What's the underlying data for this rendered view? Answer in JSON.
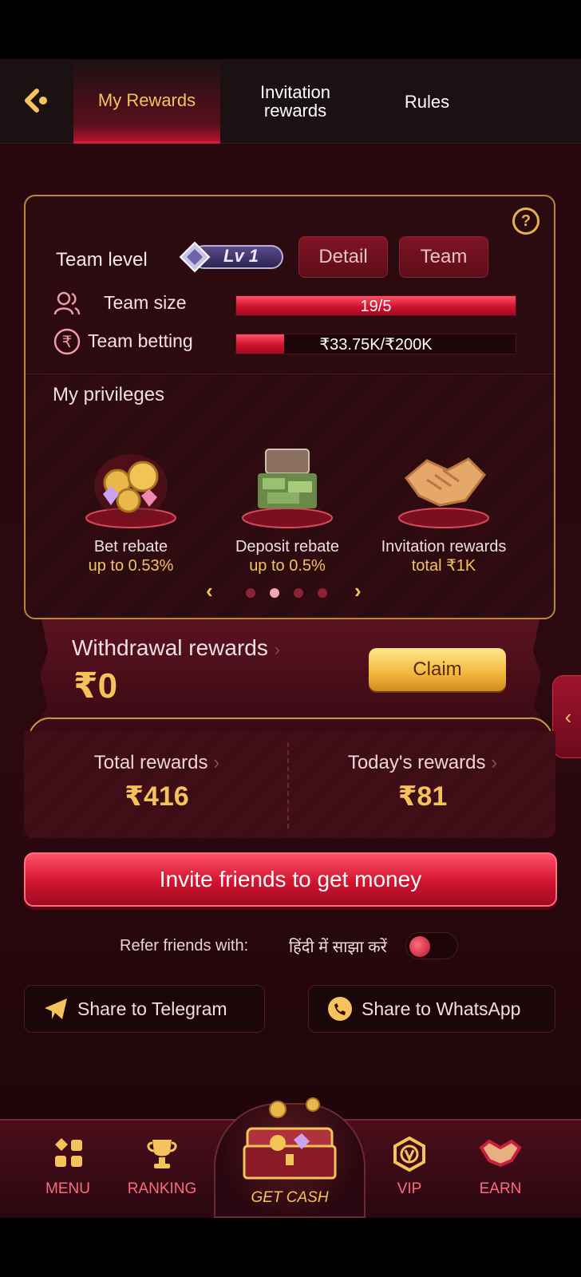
{
  "header": {
    "tabs": [
      {
        "label": "My Rewards",
        "active": true
      },
      {
        "label": "Invitation\nrewards",
        "active": false
      },
      {
        "label": "Rules",
        "active": false
      }
    ]
  },
  "team": {
    "label": "Team level",
    "level_badge": "Lv 1",
    "detail_button": "Detail",
    "team_button": "Team",
    "size_label": "Team size",
    "size_value": "19/5",
    "size_progress": 1.0,
    "betting_label": "Team betting",
    "betting_value": "₹33.75K/₹200K",
    "betting_progress": 0.17
  },
  "privileges": {
    "title": "My privileges",
    "items": [
      {
        "name": "Bet rebate",
        "value": "up to 0.53%"
      },
      {
        "name": "Deposit rebate",
        "value": "up to 0.5%"
      },
      {
        "name": "Invitation rewards",
        "value": "total ₹1K"
      }
    ],
    "active_page": 1
  },
  "withdrawal": {
    "title": "Withdrawal rewards",
    "amount": "₹0",
    "claim": "Claim"
  },
  "totals": {
    "total_label": "Total rewards",
    "total_value": "₹416",
    "today_label": "Today's rewards",
    "today_value": "₹81"
  },
  "invite_button": "Invite friends to get money",
  "refer": {
    "label": "Refer friends with:",
    "hindi": "हिंदी में साझा करें"
  },
  "share": {
    "telegram": "Share to Telegram",
    "whatsapp": "Share to WhatsApp"
  },
  "nav": {
    "menu": "MENU",
    "ranking": "RANKING",
    "getcash": "GET CASH",
    "vip": "VIP",
    "earn": "EARN"
  },
  "colors": {
    "accent": "#f4c35c",
    "primary_red": "#d1142f",
    "background": "#2a0810"
  }
}
